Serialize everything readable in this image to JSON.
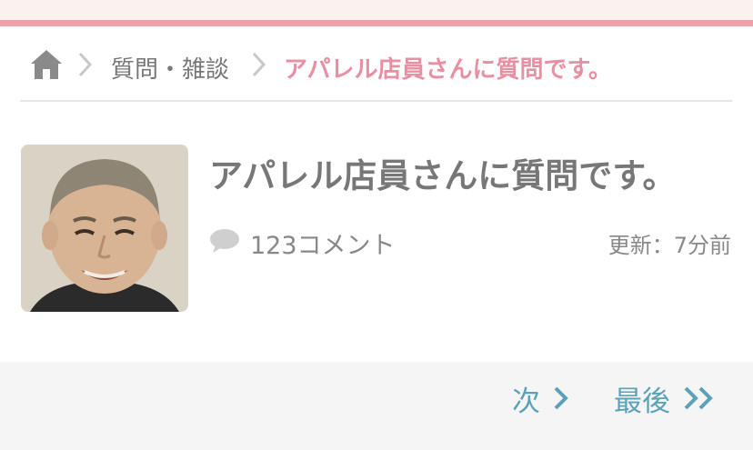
{
  "breadcrumb": {
    "home_icon": "home-icon",
    "category": "質問・雑談",
    "current": "アパレル店員さんに質問です。"
  },
  "post": {
    "title": "アパレル店員さんに質問です。",
    "comment_count": "123コメント",
    "updated": "更新：7分前"
  },
  "pagination": {
    "next_label": "次",
    "last_label": "最後"
  },
  "colors": {
    "accent_pink": "#f0a0ac",
    "link_teal": "#5ba1b8"
  }
}
